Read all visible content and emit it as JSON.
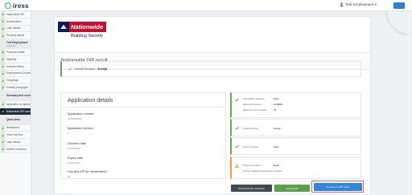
{
  "app": {
    "logo_text": "iress"
  },
  "header": {
    "user_label": "Test Employment"
  },
  "sidebar": {
    "items": [
      {
        "label": "Nationwide DIP",
        "state": "done"
      },
      {
        "label": "Authorisation",
        "state": "done"
      },
      {
        "label": "Loan details",
        "state": "done"
      },
      {
        "label": "Property details",
        "state": "done"
      },
      {
        "label": "Test Employment",
        "sub": "Applicant",
        "state": "section"
      },
      {
        "label": "Personal details",
        "state": "done"
      },
      {
        "label": "Eligibility",
        "state": "done"
      },
      {
        "label": "Address history",
        "state": "done"
      },
      {
        "label": "Employment & income",
        "state": "done"
      },
      {
        "label": "Outgoings",
        "state": "done"
      },
      {
        "label": "Existing mortgages",
        "state": "done"
      },
      {
        "label": "Summary and results",
        "state": "section"
      },
      {
        "label": "Application summary",
        "state": "done"
      },
      {
        "label": "Nationwide DIP result",
        "state": "active"
      },
      {
        "label": "Quick links",
        "state": "section"
      },
      {
        "label": "Illustrations",
        "state": "done"
      },
      {
        "label": "Client fact find",
        "state": "done"
      },
      {
        "label": "Loan details",
        "state": "done"
      },
      {
        "label": "Adviser summary",
        "state": "done"
      }
    ]
  },
  "brand": {
    "name": "Nationwide",
    "sub": "Building Society"
  },
  "result": {
    "title": "Nationwide DIP result"
  },
  "overall": {
    "label": "Overall Decision:",
    "value": "Accept"
  },
  "application": {
    "title": "Application details",
    "fields": [
      {
        "label": "Application number",
        "value": "00132564611"
      },
      {
        "label": "Application version",
        "value": "1"
      },
      {
        "label": "Decision date",
        "value": "17/06/2022"
      },
      {
        "label": "Expiry date",
        "value": "17/09/2022"
      },
      {
        "label": "Can this DIP be resubmitted?",
        "value": "No"
      }
    ]
  },
  "decisions": {
    "affordability": {
      "label": "Affordability decision",
      "value": "Pass",
      "max_label": "Maximum amount",
      "max_value": "£138000",
      "term_label": "Maximum term (Years)",
      "term_value": "25"
    },
    "credit": {
      "label": "Credit decision",
      "value": "Accept"
    },
    "policy": {
      "label": "Policy decision",
      "value": "Pass"
    },
    "property": {
      "label": "Property decision",
      "value": "Refer",
      "note": "Further valuation assessment needed"
    }
  },
  "buttons": {
    "download": "Download DIP certificate",
    "amend": "Amend DIP",
    "continue": "Continue to MP online"
  },
  "colors": {
    "pass": "#6aa84f",
    "refer": "#f0a030",
    "accent": "#2f86dd",
    "brand_red": "#c8102e",
    "brand_navy": "#001e61"
  }
}
